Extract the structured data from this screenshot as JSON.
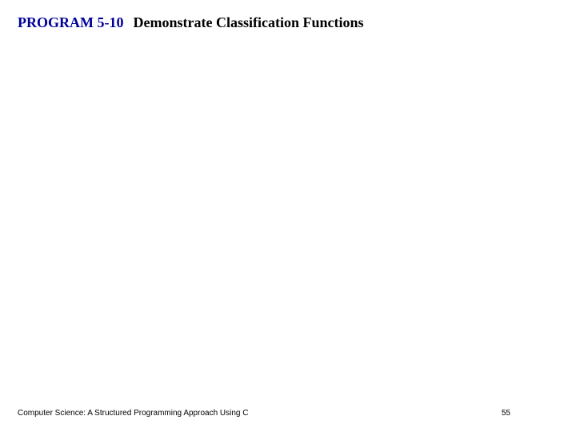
{
  "header": {
    "program_label": "PROGRAM 5-10",
    "program_title": "Demonstrate Classification Functions"
  },
  "footer": {
    "book_title": "Computer Science: A Structured Programming Approach Using C",
    "page_number": "55"
  }
}
